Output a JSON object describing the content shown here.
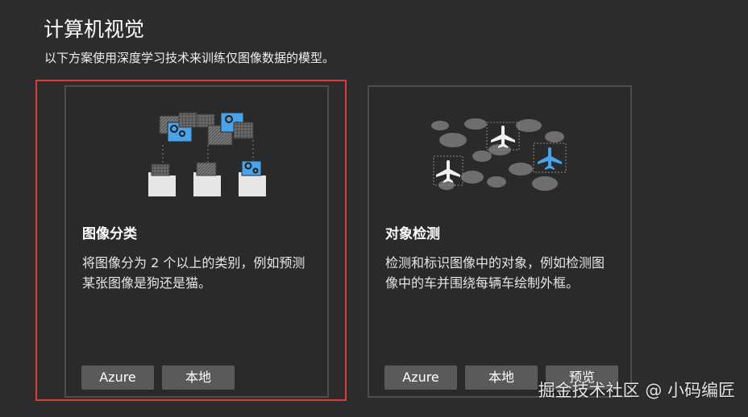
{
  "header": {
    "title": "计算机视觉",
    "subtitle": "以下方案使用深度学习技术来训练仅图像数据的模型。"
  },
  "cards": [
    {
      "title": "图像分类",
      "description": "将图像分为 2 个以上的类别，例如预测某张图像是狗还是猫。",
      "icon": "image-classification-illustration",
      "selected": true,
      "buttons": [
        "Azure",
        "本地"
      ]
    },
    {
      "title": "对象检测",
      "description": "检测和标识图像中的对象，例如检测图像中的车并围绕每辆车绘制外框。",
      "icon": "object-detection-illustration",
      "selected": false,
      "buttons": [
        "Azure",
        "本地",
        "预览"
      ]
    }
  ],
  "colors": {
    "background": "#2d2d2d",
    "card_background": "#2a2a2a",
    "card_border": "#4e4e4e",
    "selection_border": "#e03c3c",
    "button_background": "#5a5a5a",
    "accent_blue": "#4aa3e8"
  },
  "watermark": "掘金技术社区 @ 小码编匠"
}
